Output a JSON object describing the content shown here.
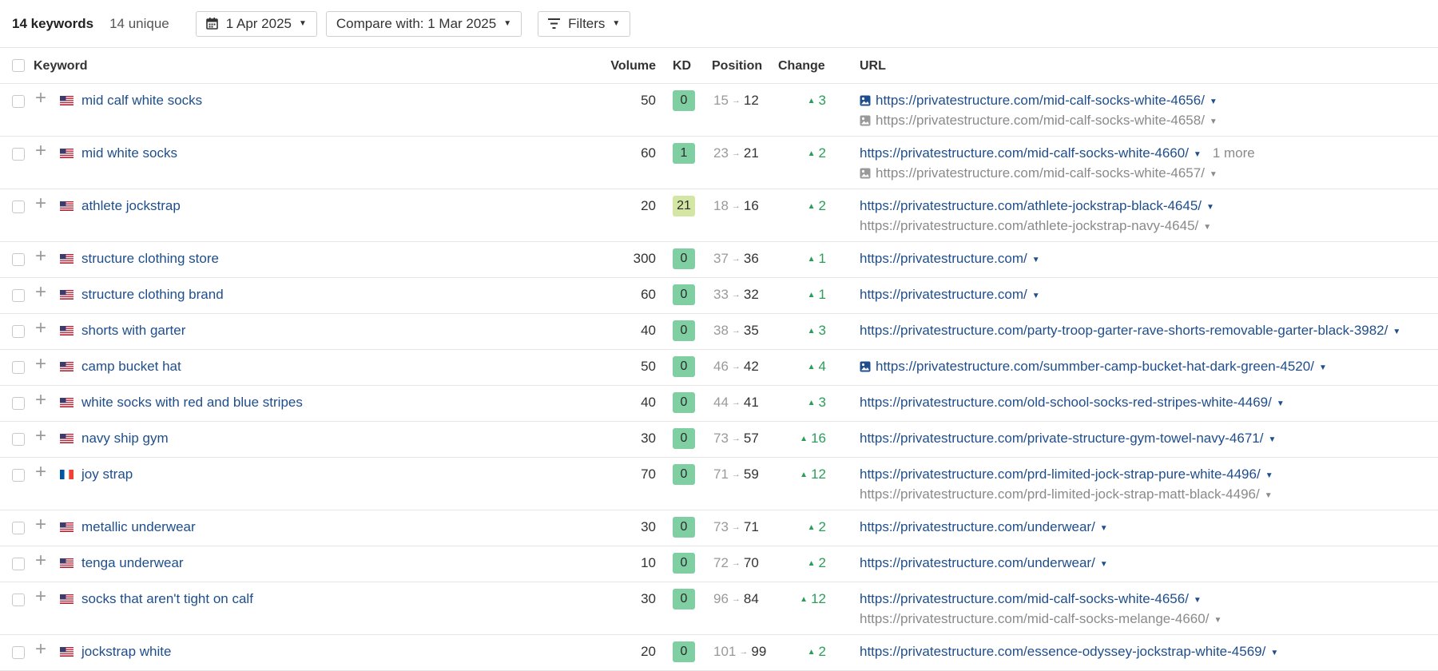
{
  "toolbar": {
    "keyword_count": "14 keywords",
    "unique_count": "14 unique",
    "date": "1 Apr 2025",
    "compare": "Compare with: 1 Mar 2025",
    "filters": "Filters"
  },
  "table": {
    "headers": {
      "keyword": "Keyword",
      "volume": "Volume",
      "kd": "KD",
      "position": "Position",
      "change": "Change",
      "url": "URL"
    },
    "rows": [
      {
        "flag": "US",
        "keyword": "mid calf white socks",
        "volume": "50",
        "kd": "0",
        "pos_old": "15",
        "pos_new": "12",
        "change": "3",
        "url": "https://privatestructure.com/mid-calf-socks-white-4656/",
        "url_icon": "image-icon",
        "more": "",
        "url2": "https://privatestructure.com/mid-calf-socks-white-4658/",
        "url2_icon": "image-icon"
      },
      {
        "flag": "US",
        "keyword": "mid white socks",
        "volume": "60",
        "kd": "1",
        "pos_old": "23",
        "pos_new": "21",
        "change": "2",
        "url": "https://privatestructure.com/mid-calf-socks-white-4660/",
        "url_icon": "",
        "more": "1 more",
        "url2": "https://privatestructure.com/mid-calf-socks-white-4657/",
        "url2_icon": "image-icon"
      },
      {
        "flag": "US",
        "keyword": "athlete jockstrap",
        "volume": "20",
        "kd": "21",
        "pos_old": "18",
        "pos_new": "16",
        "change": "2",
        "url": "https://privatestructure.com/athlete-jockstrap-black-4645/",
        "url_icon": "",
        "more": "",
        "url2": "https://privatestructure.com/athlete-jockstrap-navy-4645/",
        "url2_icon": ""
      },
      {
        "flag": "US",
        "keyword": "structure clothing store",
        "volume": "300",
        "kd": "0",
        "pos_old": "37",
        "pos_new": "36",
        "change": "1",
        "url": "https://privatestructure.com/",
        "url_icon": "",
        "more": "",
        "url2": "",
        "url2_icon": ""
      },
      {
        "flag": "US",
        "keyword": "structure clothing brand",
        "volume": "60",
        "kd": "0",
        "pos_old": "33",
        "pos_new": "32",
        "change": "1",
        "url": "https://privatestructure.com/",
        "url_icon": "",
        "more": "",
        "url2": "",
        "url2_icon": ""
      },
      {
        "flag": "US",
        "keyword": "shorts with garter",
        "volume": "40",
        "kd": "0",
        "pos_old": "38",
        "pos_new": "35",
        "change": "3",
        "url": "https://privatestructure.com/party-troop-garter-rave-shorts-removable-garter-black-3982/",
        "url_icon": "",
        "more": "",
        "url2": "",
        "url2_icon": ""
      },
      {
        "flag": "US",
        "keyword": "camp bucket hat",
        "volume": "50",
        "kd": "0",
        "pos_old": "46",
        "pos_new": "42",
        "change": "4",
        "url": "https://privatestructure.com/summber-camp-bucket-hat-dark-green-4520/",
        "url_icon": "image-icon",
        "more": "",
        "url2": "",
        "url2_icon": ""
      },
      {
        "flag": "US",
        "keyword": "white socks with red and blue stripes",
        "volume": "40",
        "kd": "0",
        "pos_old": "44",
        "pos_new": "41",
        "change": "3",
        "url": "https://privatestructure.com/old-school-socks-red-stripes-white-4469/",
        "url_icon": "",
        "more": "",
        "url2": "",
        "url2_icon": ""
      },
      {
        "flag": "US",
        "keyword": "navy ship gym",
        "volume": "30",
        "kd": "0",
        "pos_old": "73",
        "pos_new": "57",
        "change": "16",
        "url": "https://privatestructure.com/private-structure-gym-towel-navy-4671/",
        "url_icon": "",
        "more": "",
        "url2": "",
        "url2_icon": ""
      },
      {
        "flag": "FR",
        "keyword": "joy strap",
        "volume": "70",
        "kd": "0",
        "pos_old": "71",
        "pos_new": "59",
        "change": "12",
        "url": "https://privatestructure.com/prd-limited-jock-strap-pure-white-4496/",
        "url_icon": "",
        "more": "",
        "url2": "https://privatestructure.com/prd-limited-jock-strap-matt-black-4496/",
        "url2_icon": ""
      },
      {
        "flag": "US",
        "keyword": "metallic underwear",
        "volume": "30",
        "kd": "0",
        "pos_old": "73",
        "pos_new": "71",
        "change": "2",
        "url": "https://privatestructure.com/underwear/",
        "url_icon": "",
        "more": "",
        "url2": "",
        "url2_icon": ""
      },
      {
        "flag": "US",
        "keyword": "tenga underwear",
        "volume": "10",
        "kd": "0",
        "pos_old": "72",
        "pos_new": "70",
        "change": "2",
        "url": "https://privatestructure.com/underwear/",
        "url_icon": "",
        "more": "",
        "url2": "",
        "url2_icon": ""
      },
      {
        "flag": "US",
        "keyword": "socks that aren't tight on calf",
        "volume": "30",
        "kd": "0",
        "pos_old": "96",
        "pos_new": "84",
        "change": "12",
        "url": "https://privatestructure.com/mid-calf-socks-white-4656/",
        "url_icon": "",
        "more": "",
        "url2": "https://privatestructure.com/mid-calf-socks-melange-4660/",
        "url2_icon": ""
      },
      {
        "flag": "US",
        "keyword": "jockstrap white",
        "volume": "20",
        "kd": "0",
        "pos_old": "101",
        "pos_new": "99",
        "change": "2",
        "url": "https://privatestructure.com/essence-odyssey-jockstrap-white-4569/",
        "url_icon": "",
        "more": "",
        "url2": "",
        "url2_icon": ""
      }
    ]
  },
  "colors": {
    "link": "#1f4e8c",
    "positive": "#2a9d58",
    "kd_low": "#7fcfa3",
    "kd_mid": "#d3e6a4",
    "muted": "#8a8a8a"
  }
}
